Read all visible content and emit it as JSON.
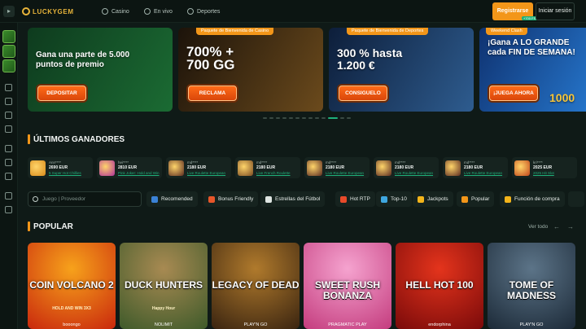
{
  "header": {
    "logo_text": "LUCKYGEM",
    "nav": [
      {
        "label": "Casino",
        "icon": "spade-icon"
      },
      {
        "label": "En vivo",
        "icon": "live-icon"
      },
      {
        "label": "Deportes",
        "icon": "soccer-ball-icon"
      }
    ],
    "register_label": "Registrarse",
    "register_badge": "+700 FS",
    "login_label": "Iniciar sesión"
  },
  "banners": [
    {
      "tag": "",
      "headline": "Gana una parte de 5.000 puntos de premio",
      "cta": "DEPOSITAR",
      "colors": [
        "#0e3b1e",
        "#1b6b33"
      ]
    },
    {
      "tag": "Paquete de Bienvenida de Casino",
      "headline": "700% + 700 GG",
      "cta": "RECLAMA",
      "colors": [
        "#1c130a",
        "#6b4a1c"
      ]
    },
    {
      "tag": "Paquete de Bienvenida de Deportes",
      "headline": "300 % hasta 1.200 €",
      "cta": "CONSIGUELO",
      "colors": [
        "#0d1e3a",
        "#2e5c8f"
      ]
    },
    {
      "tag": "Weekend Clash",
      "headline": "¡Gana A LO GRANDE cada FIN DE SEMANA!",
      "cta": "¡JUEGA AHORA",
      "amount": "1000",
      "colors": [
        "#0f3270",
        "#2574c9"
      ]
    }
  ],
  "carousel": {
    "total": 13,
    "active": 10
  },
  "sections": {
    "winners_title": "ÚLTIMOS GANADORES",
    "popular_title": "POPULAR",
    "view_all": "Ver todo"
  },
  "winners": [
    {
      "user": "Ann****",
      "amount": "2690 EUR",
      "game": "5 Super Hot Chillies",
      "thumb": "#d98a1a"
    },
    {
      "user": "hei****",
      "amount": "2810 EUR",
      "game": "Pink Joker: Hold and Win",
      "thumb": "#b0309a"
    },
    {
      "user": "md****",
      "amount": "2180 EUR",
      "game": "Live Roulette European",
      "thumb": "#5a2a20"
    },
    {
      "user": "md****",
      "amount": "2180 EUR",
      "game": "Live French Roulette",
      "thumb": "#7a4a22"
    },
    {
      "user": "md****",
      "amount": "2180 EUR",
      "game": "Live Roulette European",
      "thumb": "#5a2a20"
    },
    {
      "user": "md****",
      "amount": "2180 EUR",
      "game": "Live Roulette European",
      "thumb": "#5a2a20"
    },
    {
      "user": "md****",
      "amount": "2180 EUR",
      "game": "Live Roulette European",
      "thumb": "#5a2a20"
    },
    {
      "user": "kri****",
      "amount": "2025 EUR",
      "game": "2025 Hit Slot",
      "thumb": "#c2461a"
    }
  ],
  "search": {
    "placeholder": "Juego | Proveedor"
  },
  "filters": [
    {
      "label": "Recomended",
      "icon_color": "#3b82d6"
    },
    {
      "label": "Bonus Friendly",
      "icon_color": "#e8562a"
    },
    {
      "label": "Estrellas del Fútbol",
      "icon_color": "#dfe6e3"
    },
    {
      "label": "Hot RTP",
      "icon_color": "#e84a2a"
    },
    {
      "label": "Top-10",
      "icon_color": "#3fa7e0"
    },
    {
      "label": "Jackpots",
      "icon_color": "#f3b41a"
    },
    {
      "label": "Popular",
      "icon_color": "#f39619"
    },
    {
      "label": "Función de compra",
      "icon_color": "#f3b41a"
    }
  ],
  "games": [
    {
      "title": "COIN VOLCANO 2",
      "subtitle": "HOLD AND WIN 3X3",
      "provider": "booongo",
      "colors": [
        "#c9280d",
        "#f7a21b"
      ]
    },
    {
      "title": "DUCK HUNTERS",
      "subtitle": "Happy Hour",
      "provider": "NOLIMIT",
      "colors": [
        "#3e5a2a",
        "#a88a52"
      ]
    },
    {
      "title": "LEGACY OF DEAD",
      "subtitle": "",
      "provider": "PLAY'N GO",
      "colors": [
        "#3a2410",
        "#b07a2c"
      ]
    },
    {
      "title": "SWEET RUSH BONANZA",
      "subtitle": "",
      "provider": "PRAGMATIC PLAY",
      "colors": [
        "#c43c7e",
        "#f5a3cf"
      ]
    },
    {
      "title": "HELL HOT 100",
      "subtitle": "",
      "provider": "endorphina",
      "colors": [
        "#7a0a0a",
        "#e4341c"
      ]
    },
    {
      "title": "TOME OF MADNESS",
      "subtitle": "",
      "provider": "PLAY'N GO",
      "colors": [
        "#1c2a38",
        "#5c7488"
      ]
    }
  ]
}
